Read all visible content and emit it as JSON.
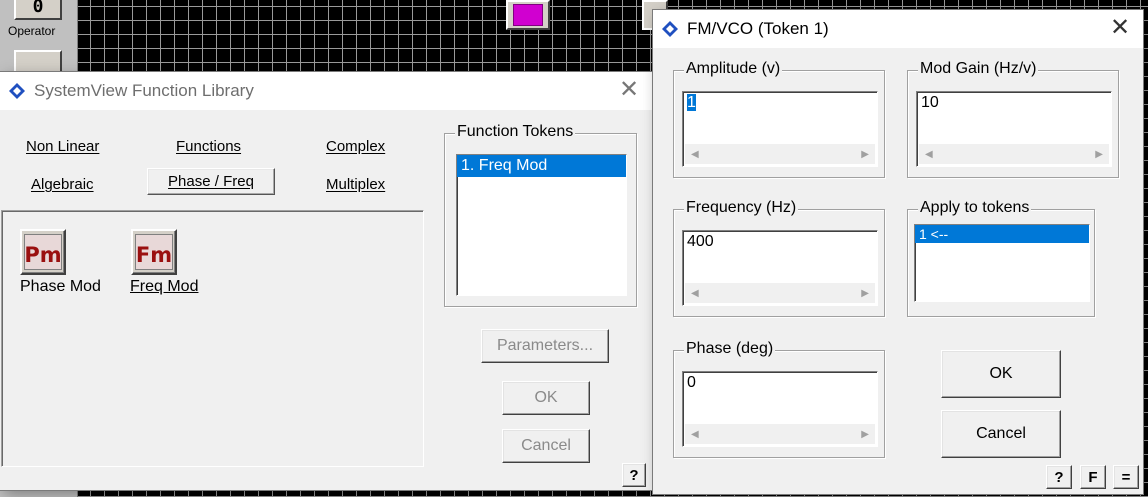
{
  "background": {
    "operator_label": "Operator",
    "operator_glyph": "0"
  },
  "library": {
    "title": "SystemView Function Library",
    "tabs": [
      {
        "label": "Non Linear"
      },
      {
        "label": "Functions"
      },
      {
        "label": "Complex"
      },
      {
        "label": "Algebraic"
      },
      {
        "label": "Phase / Freq",
        "selected": true
      },
      {
        "label": "Multiplex"
      }
    ],
    "tools": [
      {
        "glyph": "Pm",
        "label": "Phase Mod"
      },
      {
        "glyph": "Fm",
        "label": "Freq Mod"
      }
    ],
    "tokens_group_title": "Function Tokens",
    "tokens": [
      "1. Freq Mod"
    ],
    "parameters_label": "Parameters...",
    "ok_label": "OK",
    "cancel_label": "Cancel",
    "help_label": "?"
  },
  "fm_dialog": {
    "title": "FM/VCO (Token 1)",
    "fields": {
      "amplitude": {
        "label": "Amplitude (v)",
        "value": "1"
      },
      "mod_gain": {
        "label": "Mod Gain (Hz/v)",
        "value": "10"
      },
      "frequency": {
        "label": "Frequency (Hz)",
        "value": "400"
      },
      "phase": {
        "label": "Phase (deg)",
        "value": "0"
      }
    },
    "apply_group_title": "Apply to tokens",
    "apply_items": [
      "1 <--"
    ],
    "ok_label": "OK",
    "cancel_label": "Cancel",
    "help_label": "?",
    "f_label": "F",
    "eq_label": "="
  },
  "colors": {
    "accent": "#0078d7",
    "icon_text": "#9a1010"
  }
}
